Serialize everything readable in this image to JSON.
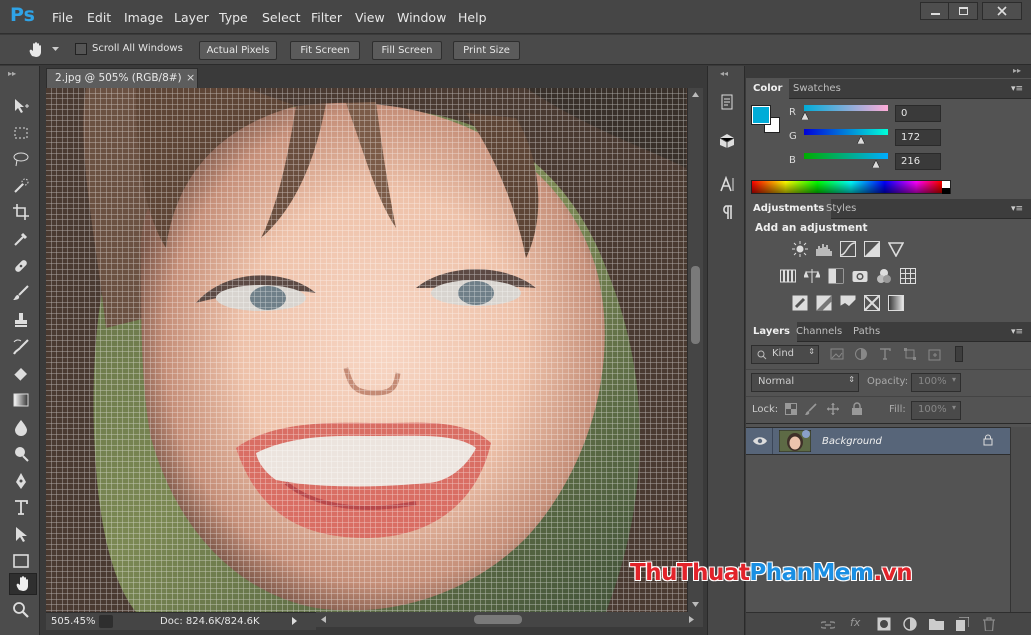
{
  "app": {
    "logo": "Ps"
  },
  "menu": [
    "File",
    "Edit",
    "Image",
    "Layer",
    "Type",
    "Select",
    "Filter",
    "View",
    "Window",
    "Help"
  ],
  "window_controls": [
    "minimize-icon",
    "maximize-icon",
    "close-icon"
  ],
  "options_bar": {
    "scroll_all_windows": "Scroll All Windows",
    "actual_pixels": "Actual Pixels",
    "fit_screen": "Fit Screen",
    "fill_screen": "Fill Screen",
    "print_size": "Print Size"
  },
  "document": {
    "tab_title": "2.jpg @ 505% (RGB/8#)",
    "close_glyph": "×",
    "zoom": "505.45%",
    "doc_size": "Doc: 824.6K/824.6K"
  },
  "tools": [
    "move-tool",
    "marquee-tool",
    "lasso-tool",
    "quick-select-tool",
    "crop-tool",
    "eyedropper-tool",
    "healing-brush-tool",
    "brush-tool",
    "clone-stamp-tool",
    "history-brush-tool",
    "eraser-tool",
    "gradient-tool",
    "blur-tool",
    "dodge-tool",
    "pen-tool",
    "type-tool",
    "path-select-tool",
    "shape-tool",
    "hand-tool",
    "zoom-tool"
  ],
  "color_panel": {
    "tabs": [
      "Color",
      "Swatches"
    ],
    "foreground": "#00acd8",
    "channels": [
      {
        "label": "R",
        "value": "0",
        "fraction": 0.0
      },
      {
        "label": "G",
        "value": "172",
        "fraction": 0.675
      },
      {
        "label": "B",
        "value": "216",
        "fraction": 0.847
      }
    ]
  },
  "adjustments_panel": {
    "tabs": [
      "Adjustments",
      "Styles"
    ],
    "heading": "Add an adjustment",
    "row1": [
      "brightness-icon",
      "levels-icon",
      "curves-icon",
      "exposure-icon",
      "vibrance-icon"
    ],
    "row2": [
      "hue-saturation-icon",
      "color-balance-icon",
      "black-white-icon",
      "photo-filter-icon",
      "channel-mixer-icon",
      "color-lookup-icon"
    ],
    "row3": [
      "invert-icon",
      "posterize-icon",
      "threshold-icon",
      "selective-color-icon",
      "gradient-map-icon"
    ]
  },
  "layers_panel": {
    "tabs": [
      "Layers",
      "Channels",
      "Paths"
    ],
    "kind_label": "Kind",
    "blend_mode": "Normal",
    "opacity_label": "Opacity:",
    "opacity_value": "100%",
    "lock_label": "Lock:",
    "fill_label": "Fill:",
    "fill_value": "100%",
    "layer_name": "Background"
  },
  "watermark": {
    "part1": "ThuThuat",
    "part2": "PhanMem",
    "part3": ".vn",
    "c1": "#e2232a",
    "c2": "#1a8fe3",
    "c3": "#e2232a"
  }
}
